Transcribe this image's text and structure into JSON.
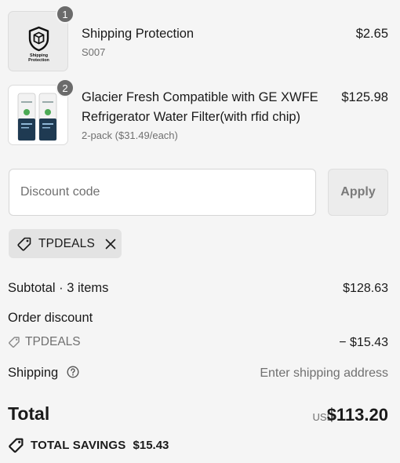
{
  "line_items": [
    {
      "quantity": "1",
      "title": "Shipping Protection",
      "subtitle": "S007",
      "price": "$2.65",
      "image_logo_text": "Shipping Protection"
    },
    {
      "quantity": "2",
      "title_line1": "Glacier Fresh Compatible with GE XWFE",
      "title_line2": "Refrigerator Water Filter(with rfid chip)",
      "subtitle": "2-pack ($31.49/each)",
      "price": "$125.98",
      "image_icon": "water-filter-pack-image"
    }
  ],
  "discount": {
    "placeholder": "Discount code",
    "apply_label": "Apply",
    "applied_code": "TPDEALS",
    "tag_icon": "tag-icon",
    "remove_icon": "close-icon"
  },
  "summary": {
    "subtotal_label": "Subtotal · 3 items",
    "subtotal_value": "$128.63",
    "order_discount_label": "Order discount",
    "order_discount_code": "TPDEALS",
    "order_discount_value": "− $15.43",
    "shipping_label": "Shipping",
    "shipping_value": "Enter shipping address",
    "help_icon": "question-circle-icon",
    "total_label": "Total",
    "currency": "USD",
    "total_value": "$113.20",
    "savings_label": "TOTAL SAVINGS",
    "savings_value": "$15.43"
  },
  "colors": {
    "background": "#f5f5f5",
    "text": "#1a1a1a",
    "muted": "#707070",
    "badge": "#6b6b6b"
  }
}
